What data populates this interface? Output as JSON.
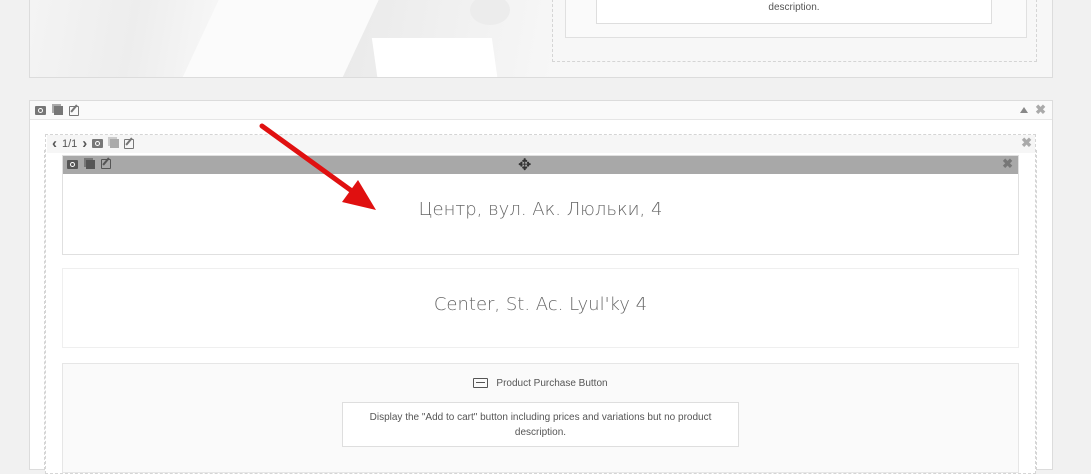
{
  "previous_module": {
    "description_tail": "description."
  },
  "row": {
    "controls": {
      "collapse_icon": "caret-up-icon",
      "remove_icon": "close-icon"
    }
  },
  "column": {
    "pager": "1/1"
  },
  "modules": [
    {
      "type": "text",
      "text": "Центр, вул. Ак. Люльки, 4",
      "active": true
    },
    {
      "type": "text",
      "text": "Center, St. Ac. Lyul'ky 4"
    },
    {
      "type": "product-purchase-button",
      "title": "Product Purchase Button",
      "description": "Display the \"Add to cart\" button including prices and variations but no product description."
    }
  ],
  "annotation": {
    "color": "#e01010"
  }
}
